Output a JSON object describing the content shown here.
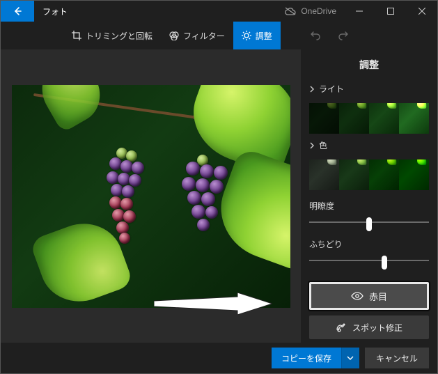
{
  "titlebar": {
    "app_name": "フォト",
    "onedrive_label": "OneDrive"
  },
  "toolbar": {
    "crop_label": "トリミングと回転",
    "filter_label": "フィルター",
    "adjust_label": "調整"
  },
  "side": {
    "title": "調整",
    "light_label": "ライト",
    "color_label": "色",
    "clarity_label": "明瞭度",
    "vignette_label": "ふちどり",
    "redeye_label": "赤目",
    "spotfix_label": "スポット修正",
    "clarity_value_pct": 50,
    "vignette_value_pct": 63
  },
  "footer": {
    "save_label": "コピーを保存",
    "cancel_label": "キャンセル"
  }
}
